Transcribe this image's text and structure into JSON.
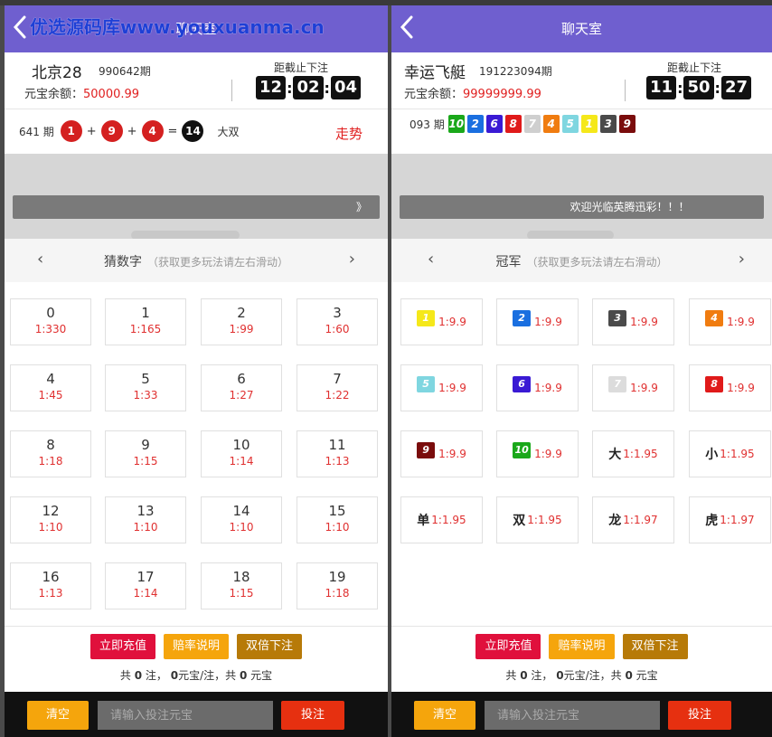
{
  "watermark": "优选源码库www.youxuanma.cn",
  "left": {
    "header_title": "聊天室",
    "game_name": "北京28",
    "period": "990642期",
    "balance_label": "元宝余额：",
    "balance": "50000.99",
    "deadline_label": "距截止下注",
    "timer": [
      "12",
      "02",
      "04"
    ],
    "last_draw": {
      "period": "641 期",
      "balls": [
        "1",
        "9",
        "4"
      ],
      "plus": "+",
      "equals": "=",
      "sum": "14",
      "result": "大双"
    },
    "trend_label": "走势",
    "chat_bar_text": "》",
    "tab": {
      "label": "猜数字",
      "hint": "（获取更多玩法请左右滑动）",
      "prev": "‹",
      "next": "›"
    },
    "options": [
      {
        "num": "0",
        "odd": "1:330"
      },
      {
        "num": "1",
        "odd": "1:165"
      },
      {
        "num": "2",
        "odd": "1:99"
      },
      {
        "num": "3",
        "odd": "1:60"
      },
      {
        "num": "4",
        "odd": "1:45"
      },
      {
        "num": "5",
        "odd": "1:33"
      },
      {
        "num": "6",
        "odd": "1:27"
      },
      {
        "num": "7",
        "odd": "1:22"
      },
      {
        "num": "8",
        "odd": "1:18"
      },
      {
        "num": "9",
        "odd": "1:15"
      },
      {
        "num": "10",
        "odd": "1:14"
      },
      {
        "num": "11",
        "odd": "1:13"
      },
      {
        "num": "12",
        "odd": "1:10"
      },
      {
        "num": "13",
        "odd": "1:10"
      },
      {
        "num": "14",
        "odd": "1:10"
      },
      {
        "num": "15",
        "odd": "1:10"
      },
      {
        "num": "16",
        "odd": "1:13"
      },
      {
        "num": "17",
        "odd": "1:14"
      },
      {
        "num": "18",
        "odd": "1:15"
      },
      {
        "num": "19",
        "odd": "1:18"
      }
    ]
  },
  "right": {
    "header_title": "聊天室",
    "game_name": "幸运飞艇",
    "period": "191223094期",
    "balance_label": "元宝余额：",
    "balance": "99999999.99",
    "deadline_label": "距截止下注",
    "timer": [
      "11",
      "50",
      "27"
    ],
    "last_draw": {
      "period": "093 期",
      "chips": [
        {
          "n": "10",
          "color": "#1aa81a"
        },
        {
          "n": "2",
          "color": "#1a6fe0"
        },
        {
          "n": "6",
          "color": "#3a1ad4"
        },
        {
          "n": "8",
          "color": "#e01a1a"
        },
        {
          "n": "7",
          "color": "#cfcfcf"
        },
        {
          "n": "4",
          "color": "#f07c10"
        },
        {
          "n": "5",
          "color": "#7fd6e0"
        },
        {
          "n": "1",
          "color": "#f5e81a"
        },
        {
          "n": "3",
          "color": "#4a4a4a"
        },
        {
          "n": "9",
          "color": "#7a0c0c"
        }
      ]
    },
    "chat_bar_text": "欢迎光临英腾迅彩！！！",
    "tab": {
      "label": "冠军",
      "hint": "（获取更多玩法请左右滑动）",
      "prev": "‹",
      "next": "›"
    },
    "options": [
      {
        "chip": "1",
        "color": "#f5e81a",
        "odd": "1:9.9"
      },
      {
        "chip": "2",
        "color": "#1a6fe0",
        "odd": "1:9.9"
      },
      {
        "chip": "3",
        "color": "#4a4a4a",
        "odd": "1:9.9"
      },
      {
        "chip": "4",
        "color": "#f07c10",
        "odd": "1:9.9"
      },
      {
        "chip": "5",
        "color": "#7fd6e0",
        "odd": "1:9.9"
      },
      {
        "chip": "6",
        "color": "#3a1ad4",
        "odd": "1:9.9"
      },
      {
        "chip": "7",
        "color": "#dcdcdc",
        "odd": "1:9.9"
      },
      {
        "chip": "8",
        "color": "#e01a1a",
        "odd": "1:9.9"
      },
      {
        "chip": "9",
        "color": "#7a0c0c",
        "odd": "1:9.9"
      },
      {
        "chip": "10",
        "color": "#1aa81a",
        "odd": "1:9.9"
      },
      {
        "word": "大",
        "odd": "1:1.95"
      },
      {
        "word": "小",
        "odd": "1:1.95"
      },
      {
        "word": "单",
        "odd": "1:1.95"
      },
      {
        "word": "双",
        "odd": "1:1.95"
      },
      {
        "word": "龙",
        "odd": "1:1.97"
      },
      {
        "word": "虎",
        "odd": "1:1.97"
      }
    ]
  },
  "actions": {
    "recharge": "立即充值",
    "odds_info": "赔率说明",
    "double_bet": "双倍下注",
    "summary_prefix": "共",
    "summary_count": "0",
    "summary_mid1": "注，",
    "summary_per": "0",
    "summary_mid2": "元宝/注，共",
    "summary_total": "0",
    "summary_suffix": "元宝"
  },
  "bottom": {
    "clear": "清空",
    "placeholder": "请输入投注元宝",
    "bet": "投注"
  },
  "colors": {
    "header": "#6f5fcf",
    "accent_red": "#e02020",
    "orange": "#f5a50c"
  }
}
